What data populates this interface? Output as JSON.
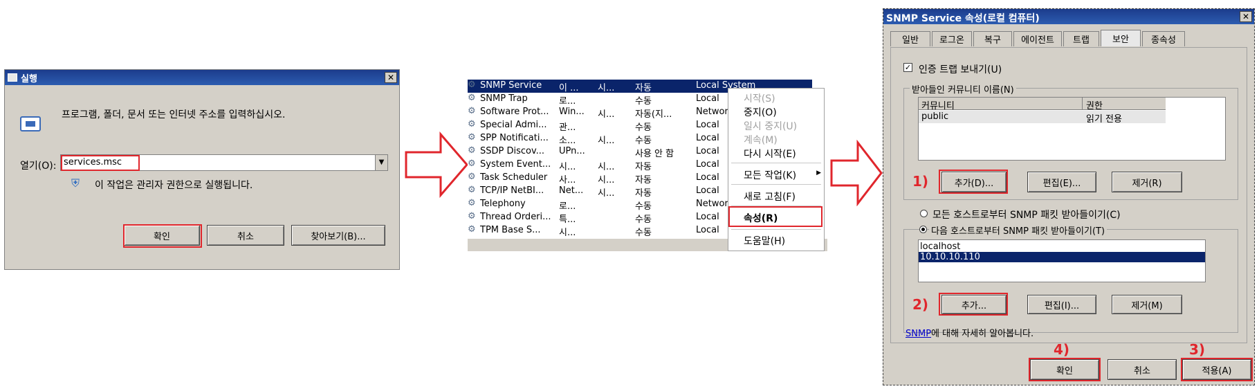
{
  "run_dialog": {
    "title": "실행",
    "description": "프로그램, 폴더, 문서 또는 인터넷 주소를 입력하십시오.",
    "open_label": "열기(O):",
    "open_value": "services.msc",
    "admin_note": "이 작업은 관리자 권한으로 실행됩니다.",
    "ok": "확인",
    "cancel": "취소",
    "browse": "찾아보기(B)..."
  },
  "services": {
    "rows": [
      {
        "name": "SNMP Service",
        "desc": "이 ...",
        "status": "시...",
        "startup": "자동",
        "logon": "Local System"
      },
      {
        "name": "SNMP Trap",
        "desc": "로...",
        "status": "",
        "startup": "수동",
        "logon": "Local"
      },
      {
        "name": "Software Prot...",
        "desc": "Win...",
        "status": "시...",
        "startup": "자동(지...",
        "logon": "Networ"
      },
      {
        "name": "Special Admi...",
        "desc": "관...",
        "status": "",
        "startup": "수동",
        "logon": "Local"
      },
      {
        "name": "SPP Notificati...",
        "desc": "소...",
        "status": "시...",
        "startup": "수동",
        "logon": "Local"
      },
      {
        "name": "SSDP Discov...",
        "desc": "UPn...",
        "status": "",
        "startup": "사용 안 함",
        "logon": "Local"
      },
      {
        "name": "System Event...",
        "desc": "시...",
        "status": "시...",
        "startup": "자동",
        "logon": "Local"
      },
      {
        "name": "Task Scheduler",
        "desc": "사...",
        "status": "시...",
        "startup": "자동",
        "logon": "Local"
      },
      {
        "name": "TCP/IP NetBI...",
        "desc": "Net...",
        "status": "시...",
        "startup": "자동",
        "logon": "Local"
      },
      {
        "name": "Telephony",
        "desc": "로...",
        "status": "",
        "startup": "수동",
        "logon": "Networ"
      },
      {
        "name": "Thread Orderi...",
        "desc": "특...",
        "status": "",
        "startup": "수동",
        "logon": "Local"
      },
      {
        "name": "TPM Base S...",
        "desc": "시...",
        "status": "",
        "startup": "수동",
        "logon": "Local"
      }
    ]
  },
  "context_menu": {
    "start": "시작(S)",
    "stop": "중지(O)",
    "pause": "일시 중지(U)",
    "resume": "계속(M)",
    "restart": "다시 시작(E)",
    "all_tasks": "모든 작업(K)",
    "refresh": "새로 고침(F)",
    "properties": "속성(R)",
    "help": "도움말(H)"
  },
  "snmp_props": {
    "title": "SNMP Service 속성(로컬 컴퓨터)",
    "tabs": [
      "일반",
      "로그온",
      "복구",
      "에이전트",
      "트랩",
      "보안",
      "종속성"
    ],
    "send_auth_trap": "인증 트랩 보내기(U)",
    "accepted_communities_title": "받아들인 커뮤니티 이름(N)",
    "col_community": "커뮤니티",
    "col_rights": "권한",
    "community_name": "public",
    "community_rights": "읽기 전용",
    "add_community": "추가(D)...",
    "edit_community": "편집(E)...",
    "remove_community": "제거(R)",
    "accept_any": "모든 호스트로부터 SNMP 패킷 받아들이기(C)",
    "accept_these": "다음 호스트로부터 SNMP 패킷 받아들이기(T)",
    "hosts": [
      "localhost",
      "10.10.10.110"
    ],
    "add_host": "추가...",
    "edit_host": "편집(I)...",
    "remove_host": "제거(M)",
    "learn_link": "SNMP",
    "learn_text": "에 대해 자세히 알아봅니다.",
    "ok": "확인",
    "cancel": "취소",
    "apply": "적용(A)",
    "steps": [
      "1)",
      "2)",
      "3)",
      "4)"
    ]
  },
  "colors": {
    "highlight": "#e0262c",
    "selection": "#0a246a"
  }
}
